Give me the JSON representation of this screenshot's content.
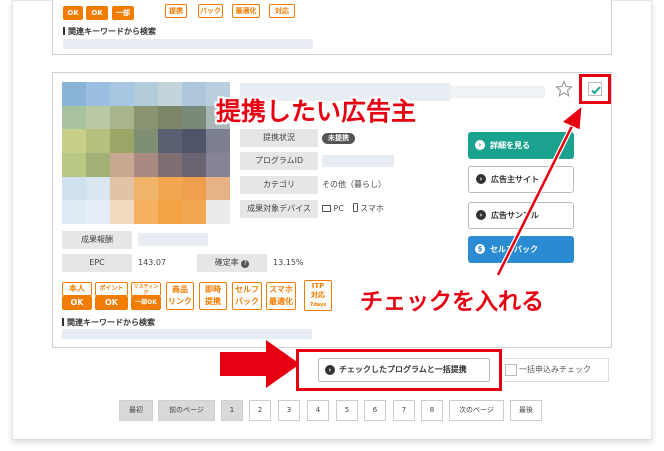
{
  "top_card": {
    "tags": [
      "OK",
      "OK",
      "一部OK",
      "提携",
      "バック",
      "最適化",
      "対応"
    ],
    "related_title": "関連キーワードから検索"
  },
  "main_card": {
    "info": {
      "status_label": "提携状況",
      "status_value": "未提携",
      "program_id_label": "プログラムID",
      "category_label": "カテゴリ",
      "category_value": "その他（暮らし）",
      "device_label": "成果対象デバイス",
      "device_pc": "PC",
      "device_sp": "スマホ",
      "reward_label": "成果報酬",
      "epc_label": "EPC",
      "epc_value": "143.07",
      "rate_label": "確定率",
      "rate_value": "13.15%"
    },
    "buttons": {
      "detail": "詳細を見る",
      "advertiser_site": "広告主サイト",
      "ad_sample": "広告サンプル",
      "self_back": "セルフバック"
    },
    "tags": [
      {
        "top": "本人",
        "bottom": "OK"
      },
      {
        "top": "ポイント",
        "bottom": "OK"
      },
      {
        "top": "リスティング",
        "bottom": "一部OK"
      },
      {
        "line1": "商品",
        "line2": "リンク"
      },
      {
        "line1": "即時",
        "line2": "提携"
      },
      {
        "line1": "セルフ",
        "line2": "バック"
      },
      {
        "line1": "スマホ",
        "line2": "最適化"
      },
      {
        "line1": "ITP",
        "line2": "対応",
        "line3": "7days"
      }
    ],
    "related_title": "関連キーワードから検索"
  },
  "annotations": {
    "advertiser": "提携したい広告主",
    "check": "チェックを入れる"
  },
  "bulk": {
    "button": "チェックしたプログラムと一括提携",
    "checkbox_label": "一括申込みチェック"
  },
  "pagination": {
    "first": "最初",
    "prev": "前のページ",
    "pages": [
      "1",
      "2",
      "3",
      "4",
      "5",
      "6",
      "7",
      "8"
    ],
    "current": "1",
    "next": "次のページ",
    "last": "最後"
  },
  "colors": {
    "accent_red": "#e60012",
    "tag_orange": "#f27c00",
    "button_green": "#1aa28e",
    "button_blue": "#2a8bd3"
  }
}
